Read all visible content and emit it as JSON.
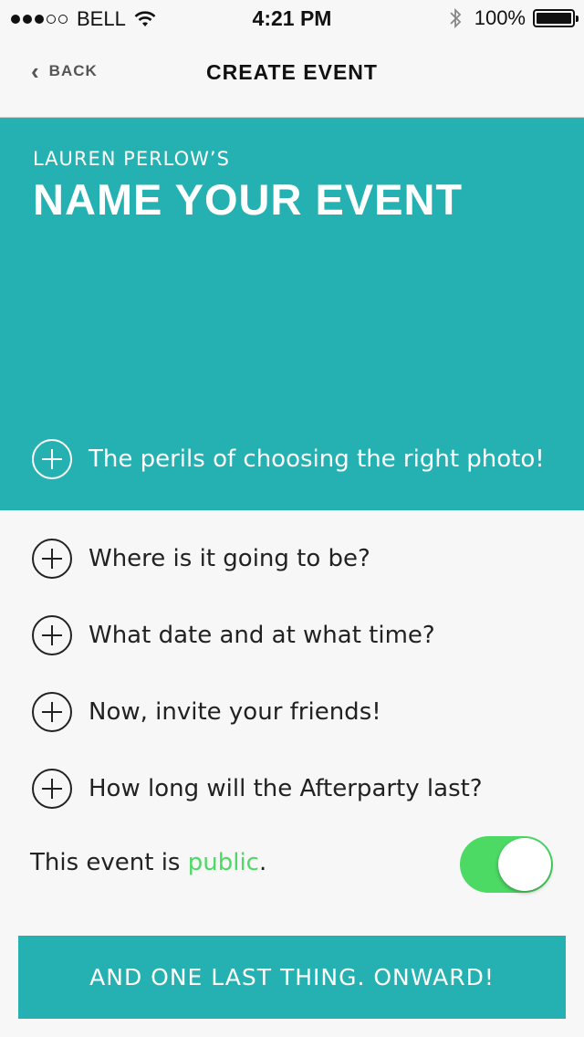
{
  "status_bar": {
    "carrier": "BELL",
    "time": "4:21 PM",
    "battery": "100%",
    "signal_filled": 3,
    "signal_total": 5,
    "icons": [
      "signal-dots-icon",
      "wifi-icon",
      "bluetooth-icon",
      "battery-icon"
    ]
  },
  "nav": {
    "back_label": "BACK",
    "title": "CREATE EVENT"
  },
  "hero": {
    "owner": "LAUREN PERLOW’S",
    "title": "NAME YOUR EVENT",
    "photo_prompt": "The perils of choosing the right photo!",
    "background_color": "#25b1b1"
  },
  "fields": {
    "location": "Where is it going to be?",
    "datetime": "What date and at what time?",
    "invite": "Now, invite your friends!",
    "duration": "How long will the Afterparty last?"
  },
  "privacy": {
    "prefix": "This event is ",
    "value": "public",
    "suffix": ".",
    "toggle_on": true,
    "accent_color": "#4cd964"
  },
  "cta": {
    "label": "AND ONE LAST THING. ONWARD!"
  }
}
